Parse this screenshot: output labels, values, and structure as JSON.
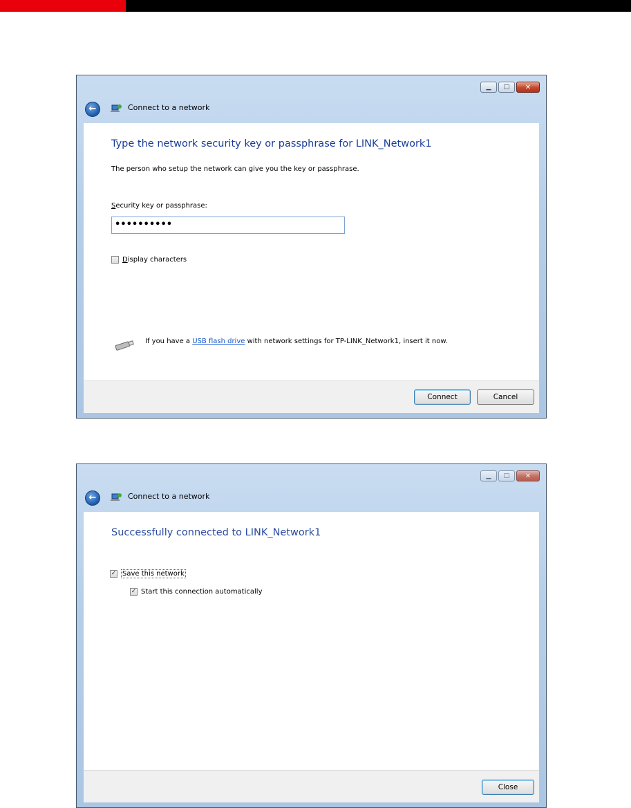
{
  "dialog1": {
    "title": "Connect to a network",
    "heading": "Type the network security key or passphrase for LINK_Network1",
    "description": "The person who setup the network can give you the key or passphrase.",
    "field_label_accel": "S",
    "field_label_rest": "ecurity key or passphrase:",
    "password_value": "••••••••••",
    "display_chars_accel": "D",
    "display_chars_rest": "isplay characters",
    "display_chars_checked": false,
    "usb_prefix": "If you have a ",
    "usb_link": "USB flash drive",
    "usb_suffix": " with network settings for TP-LINK_Network1, insert it now.",
    "connect_label": "Connect",
    "cancel_label": "Cancel"
  },
  "dialog2": {
    "title": "Connect to a network",
    "heading": "Successfully connected to LINK_Network1",
    "save_network_label": "Save this network",
    "save_network_checked": true,
    "start_auto_label": "Start this connection automatically",
    "start_auto_checked": true,
    "close_label": "Close"
  },
  "colors": {
    "top_bar_red": "#e8000b",
    "top_bar_black": "#000000",
    "heading_blue": "#1a3e9a"
  }
}
